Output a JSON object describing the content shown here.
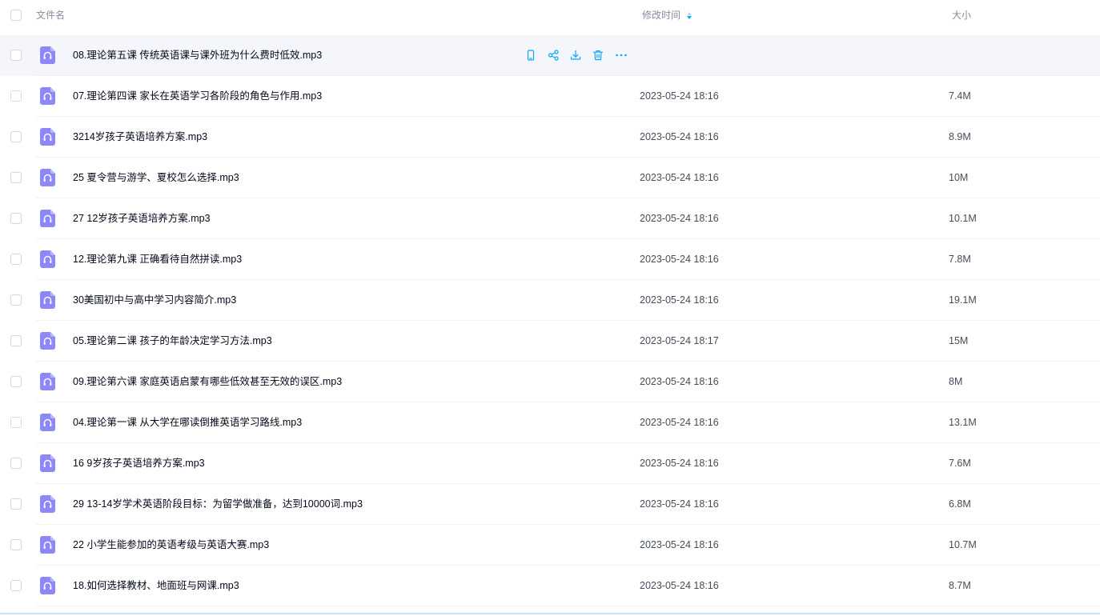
{
  "header": {
    "name_label": "文件名",
    "time_label": "修改时间",
    "size_label": "大小"
  },
  "colors": {
    "accent": "#06a7ff",
    "file_icon": "#8c88f7",
    "hover_row": "#f5f6fb"
  },
  "hover_actions": [
    {
      "icon": "phone-icon"
    },
    {
      "icon": "share-icon"
    },
    {
      "icon": "download-icon"
    },
    {
      "icon": "trash-icon"
    },
    {
      "icon": "more-icon"
    }
  ],
  "files": [
    {
      "name": "08.理论第五课 传统英语课与课外班为什么费时低效.mp3",
      "time": "",
      "size": "",
      "hovered": true
    },
    {
      "name": "07.理论第四课 家长在英语学习各阶段的角色与作用.mp3",
      "time": "2023-05-24 18:16",
      "size": "7.4M"
    },
    {
      "name": "3214岁孩子英语培养方案.mp3",
      "time": "2023-05-24 18:16",
      "size": "8.9M"
    },
    {
      "name": "25 夏令营与游学、夏校怎么选择.mp3",
      "time": "2023-05-24 18:16",
      "size": "10M"
    },
    {
      "name": "27 12岁孩子英语培养方案.mp3",
      "time": "2023-05-24 18:16",
      "size": "10.1M"
    },
    {
      "name": "12.理论第九课 正确看待自然拼读.mp3",
      "time": "2023-05-24 18:16",
      "size": "7.8M"
    },
    {
      "name": "30美国初中与高中学习内容简介.mp3",
      "time": "2023-05-24 18:16",
      "size": "19.1M"
    },
    {
      "name": "05.理论第二课 孩子的年龄决定学习方法.mp3",
      "time": "2023-05-24 18:17",
      "size": "15M"
    },
    {
      "name": "09.理论第六课 家庭英语启蒙有哪些低效甚至无效的误区.mp3",
      "time": "2023-05-24 18:16",
      "size": "8M"
    },
    {
      "name": "04.理论第一课 从大学在哪读倒推英语学习路线.mp3",
      "time": "2023-05-24 18:16",
      "size": "13.1M"
    },
    {
      "name": "16 9岁孩子英语培养方案.mp3",
      "time": "2023-05-24 18:16",
      "size": "7.6M"
    },
    {
      "name": "29 13-14岁学术英语阶段目标：为留学做准备，达到10000词.mp3",
      "time": "2023-05-24 18:16",
      "size": "6.8M"
    },
    {
      "name": "22 小学生能参加的英语考级与英语大赛.mp3",
      "time": "2023-05-24 18:16",
      "size": "10.7M"
    },
    {
      "name": "18.如何选择教材、地面班与网课.mp3",
      "time": "2023-05-24 18:16",
      "size": "8.7M"
    }
  ]
}
